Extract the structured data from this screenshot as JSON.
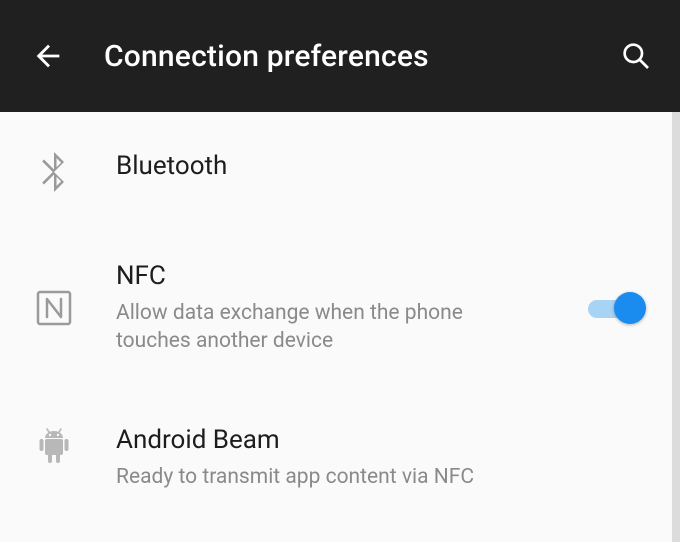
{
  "header": {
    "title": "Connection preferences"
  },
  "items": {
    "bluetooth": {
      "label": "Bluetooth"
    },
    "nfc": {
      "label": "NFC",
      "description": "Allow data exchange when the phone touches another device",
      "enabled": true
    },
    "beam": {
      "label": "Android Beam",
      "description": "Ready to transmit app content via NFC"
    }
  },
  "colors": {
    "appbar": "#202020",
    "accent": "#1a8cf0"
  }
}
